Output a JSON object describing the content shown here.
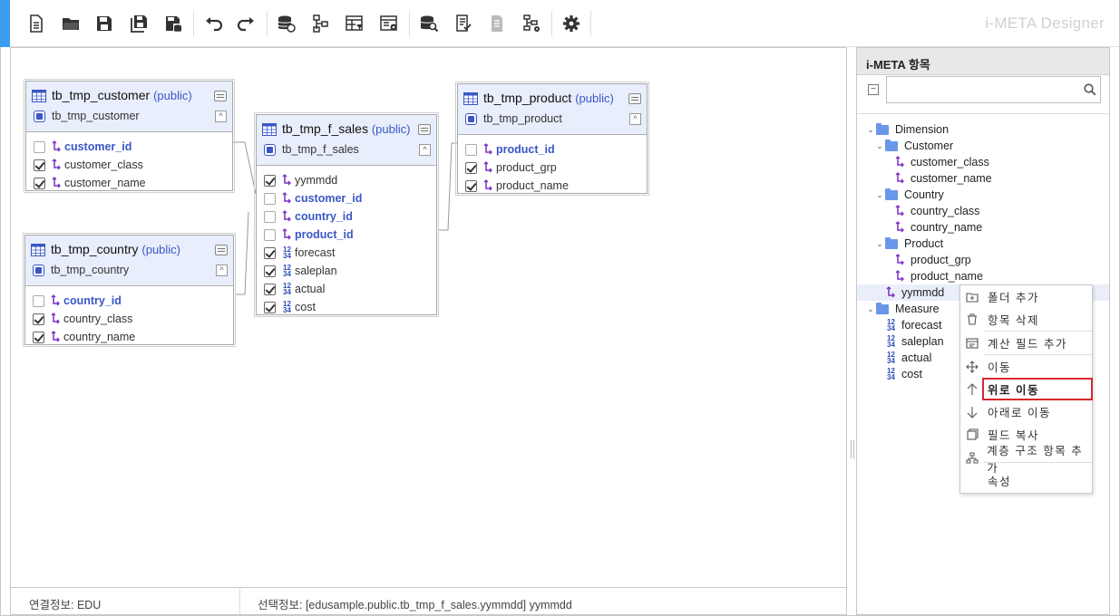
{
  "app": {
    "brand": "i-META Designer"
  },
  "toolbar": {
    "buttons": [
      {
        "name": "new-file-icon"
      },
      {
        "name": "open-folder-icon"
      },
      {
        "name": "save-icon"
      },
      {
        "name": "save-all-icon"
      },
      {
        "name": "save-db-icon"
      },
      {
        "name": "undo-icon"
      },
      {
        "name": "redo-icon"
      },
      {
        "name": "db-connect-icon"
      },
      {
        "name": "hierarchy-icon"
      },
      {
        "name": "table-filter-icon"
      },
      {
        "name": "table-settings-icon"
      },
      {
        "name": "db-search-icon"
      },
      {
        "name": "checklist-icon"
      },
      {
        "name": "document-icon"
      },
      {
        "name": "tree-settings-icon"
      },
      {
        "name": "gear-icon"
      }
    ]
  },
  "tables": [
    {
      "title": "tb_tmp_customer",
      "schema": "(public)",
      "subtitle": "tb_tmp_customer",
      "fields": [
        {
          "label": "customer_id",
          "checked": false,
          "key": true,
          "kind": "dim"
        },
        {
          "label": "customer_class",
          "checked": true,
          "key": false,
          "kind": "dim"
        },
        {
          "label": "customer_name",
          "checked": true,
          "key": false,
          "kind": "dim"
        }
      ]
    },
    {
      "title": "tb_tmp_country",
      "schema": "(public)",
      "subtitle": "tb_tmp_country",
      "fields": [
        {
          "label": "country_id",
          "checked": false,
          "key": true,
          "kind": "dim"
        },
        {
          "label": "country_class",
          "checked": true,
          "key": false,
          "kind": "dim"
        },
        {
          "label": "country_name",
          "checked": true,
          "key": false,
          "kind": "dim"
        }
      ]
    },
    {
      "title": "tb_tmp_f_sales",
      "schema": "(public)",
      "subtitle": "tb_tmp_f_sales",
      "fields": [
        {
          "label": "yymmdd",
          "checked": true,
          "key": false,
          "kind": "dim"
        },
        {
          "label": "customer_id",
          "checked": false,
          "key": true,
          "kind": "dim"
        },
        {
          "label": "country_id",
          "checked": false,
          "key": true,
          "kind": "dim"
        },
        {
          "label": "product_id",
          "checked": false,
          "key": true,
          "kind": "dim"
        },
        {
          "label": "forecast",
          "checked": true,
          "key": false,
          "kind": "num"
        },
        {
          "label": "saleplan",
          "checked": true,
          "key": false,
          "kind": "num"
        },
        {
          "label": "actual",
          "checked": true,
          "key": false,
          "kind": "num"
        },
        {
          "label": "cost",
          "checked": true,
          "key": false,
          "kind": "num"
        }
      ]
    },
    {
      "title": "tb_tmp_product",
      "schema": "(public)",
      "subtitle": "tb_tmp_product",
      "fields": [
        {
          "label": "product_id",
          "checked": false,
          "key": true,
          "kind": "dim"
        },
        {
          "label": "product_grp",
          "checked": true,
          "key": false,
          "kind": "dim"
        },
        {
          "label": "product_name",
          "checked": true,
          "key": false,
          "kind": "dim"
        }
      ]
    }
  ],
  "status": {
    "connection": "연결정보: EDU",
    "selection": "선택정보: [edusample.public.tb_tmp_f_sales.yymmdd] yymmdd"
  },
  "panel": {
    "title": "i-META 항목",
    "search_value": "",
    "tree": [
      {
        "label": "Dimension",
        "type": "folder",
        "level": 0,
        "expanded": true
      },
      {
        "label": "Customer",
        "type": "folder",
        "level": 1,
        "expanded": true
      },
      {
        "label": "customer_class",
        "type": "dim",
        "level": 2
      },
      {
        "label": "customer_name",
        "type": "dim",
        "level": 2
      },
      {
        "label": "Country",
        "type": "folder",
        "level": 1,
        "expanded": true
      },
      {
        "label": "country_class",
        "type": "dim",
        "level": 2
      },
      {
        "label": "country_name",
        "type": "dim",
        "level": 2
      },
      {
        "label": "Product",
        "type": "folder",
        "level": 1,
        "expanded": true
      },
      {
        "label": "product_grp",
        "type": "dim",
        "level": 2
      },
      {
        "label": "product_name",
        "type": "dim",
        "level": 2
      },
      {
        "label": "yymmdd",
        "type": "dim",
        "level": 1,
        "selected": true
      },
      {
        "label": "Measure",
        "type": "folder",
        "level": 0,
        "expanded": true
      },
      {
        "label": "forecast",
        "type": "num",
        "level": 1
      },
      {
        "label": "saleplan",
        "type": "num",
        "level": 1
      },
      {
        "label": "actual",
        "type": "num",
        "level": 1
      },
      {
        "label": "cost",
        "type": "num",
        "level": 1
      }
    ]
  },
  "context_menu": {
    "items": [
      {
        "label": "폴더 추가",
        "icon": "folder-add-icon"
      },
      {
        "label": "항목 삭제",
        "icon": "trash-icon"
      },
      {
        "label": "계산 필드 추가",
        "icon": "calc-field-icon"
      },
      {
        "label": "이동",
        "icon": "move-icon"
      },
      {
        "label": "위로 이동",
        "icon": "arrow-up-icon",
        "highlighted": true
      },
      {
        "label": "아래로 이동",
        "icon": "arrow-down-icon"
      },
      {
        "label": "필드 복사",
        "icon": "copy-icon"
      },
      {
        "label": "계층 구조 항목 추가",
        "icon": "hierarchy-add-icon"
      },
      {
        "label": "속성",
        "icon": ""
      }
    ]
  },
  "colors": {
    "accent": "#3a9bf0",
    "key_field": "#3b57c6",
    "highlight": "#d8262e",
    "header_bg": "#e8eefb"
  }
}
